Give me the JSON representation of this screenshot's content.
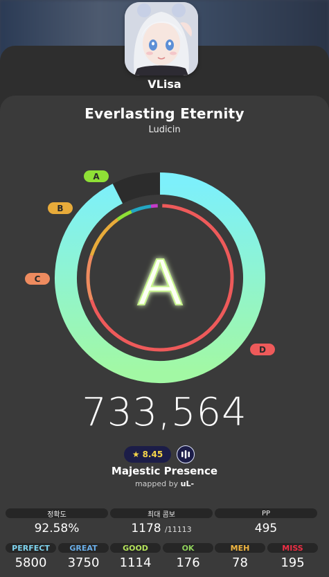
{
  "player": {
    "name": "VLisa"
  },
  "beatmap": {
    "title": "Everlasting Eternity",
    "artist": "Ludicin",
    "difficulty": "Majestic Presence",
    "mapped_by_label": "mapped by",
    "mapper": "uL-",
    "star_rating": "8.45"
  },
  "result": {
    "rank": "A",
    "score": "733,564",
    "accuracy_percent": 92.58,
    "rank_tags": [
      "A",
      "B",
      "C",
      "D"
    ]
  },
  "stats": [
    {
      "label": "정확도",
      "value": "92.58%",
      "sub": ""
    },
    {
      "label": "최대 콤보",
      "value": "1178",
      "sub": "/11113"
    },
    {
      "label": "PP",
      "value": "495",
      "sub": ""
    }
  ],
  "judgements": [
    {
      "label": "PERFECT",
      "value": "5800",
      "color": "#7fd4ef"
    },
    {
      "label": "GREAT",
      "value": "3750",
      "color": "#6aaee8"
    },
    {
      "label": "GOOD",
      "value": "1114",
      "color": "#b5e35b"
    },
    {
      "label": "OK",
      "value": "176",
      "color": "#8ed05a"
    },
    {
      "label": "MEH",
      "value": "78",
      "color": "#f1b640"
    },
    {
      "label": "MISS",
      "value": "195",
      "color": "#ee2f45"
    }
  ],
  "colors": {
    "rank_A": "#8fe036",
    "rank_B": "#e8ab3a",
    "rank_C": "#ee8b5f",
    "rank_D": "#ee5a5a",
    "ring_top": "#7df0fb",
    "ring_bottom": "#a2f8a4",
    "inner_ring": "#ee5a5a",
    "star_pill_bg": "#1c1d48"
  }
}
